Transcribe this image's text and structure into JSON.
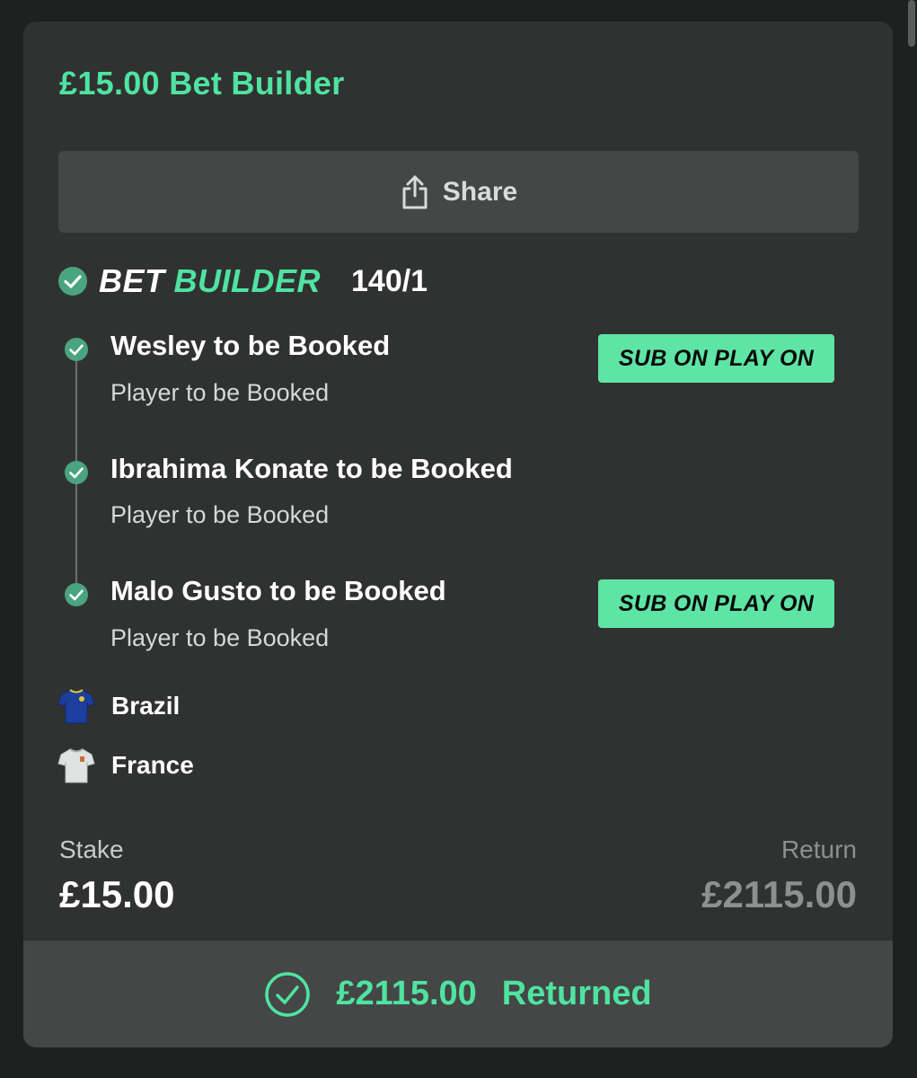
{
  "colors": {
    "accent": "#4fe3a1",
    "badge": "#5ee5a6",
    "card": "#303231",
    "panel": "#444746",
    "muted": "#8d908f"
  },
  "bet": {
    "title": "£15.00 Bet Builder",
    "share_label": "Share",
    "type_word_1": "BET",
    "type_word_2": "BUILDER",
    "odds": "140/1"
  },
  "legs": [
    {
      "title": "Wesley to be Booked",
      "subtitle": "Player to be Booked",
      "badge": "SUB ON PLAY ON",
      "status_icon": "check-icon"
    },
    {
      "title": "Ibrahima Konate to be Booked",
      "subtitle": "Player to be Booked",
      "status_icon": "check-icon"
    },
    {
      "title": "Malo Gusto to be Booked",
      "subtitle": "Player to be Booked",
      "badge": "SUB ON PLAY ON",
      "status_icon": "check-icon"
    }
  ],
  "teams": [
    {
      "name": "Brazil",
      "icon": "blue-shirt-icon"
    },
    {
      "name": "France",
      "icon": "white-shirt-icon"
    }
  ],
  "summary": {
    "stake_label": "Stake",
    "stake_value": "£15.00",
    "return_label": "Return",
    "return_value": "£2115.00"
  },
  "footer": {
    "amount": "£2115.00",
    "status": "Returned"
  }
}
